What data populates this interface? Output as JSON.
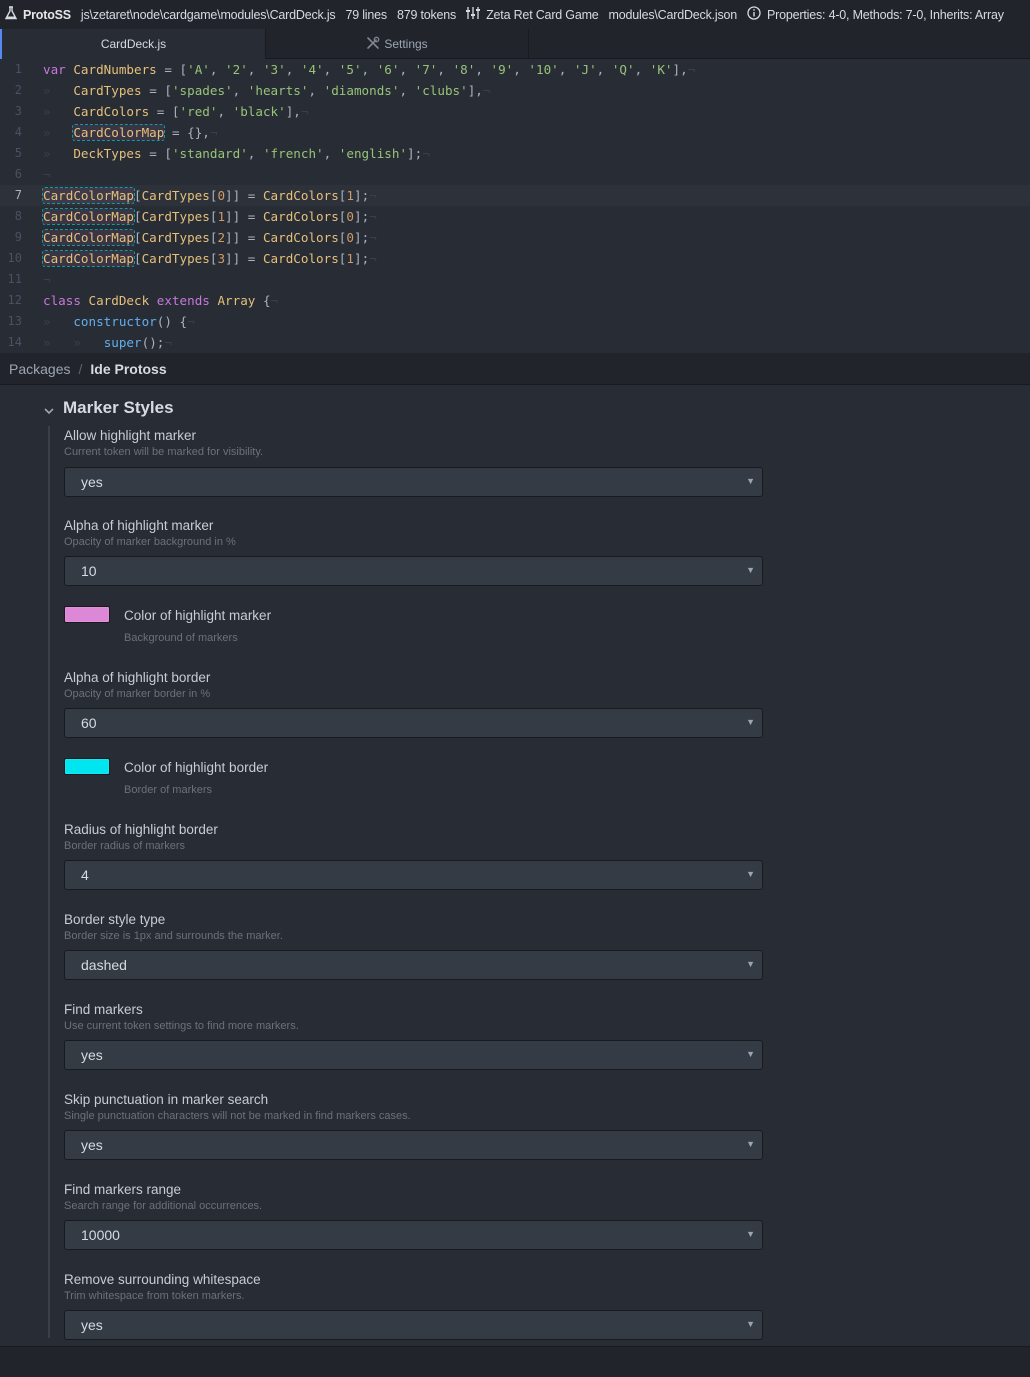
{
  "statusbar": {
    "app_name": "ProtoSS",
    "file_path": "js\\zetaret\\node\\cardgame\\modules\\CardDeck.js",
    "lines": "79 lines",
    "tokens": "879 tokens",
    "project": "Zeta Ret Card Game",
    "json_file": "modules\\CardDeck.json",
    "info": "Properties: 4-0, Methods: 7-0, Inherits: Array"
  },
  "tabs": [
    {
      "label": "CardDeck.js",
      "active": true
    },
    {
      "label": "Settings",
      "active": false,
      "icon": "settings-tools-icon"
    }
  ],
  "editor": {
    "line_numbers": [
      "1",
      "2",
      "3",
      "4",
      "5",
      "6",
      "7",
      "8",
      "9",
      "10",
      "11",
      "12",
      "13",
      "14"
    ],
    "current_line": 7
  },
  "breadcrumb": {
    "root": "Packages",
    "separator": "/",
    "current": "Ide Protoss"
  },
  "settings": {
    "section_title": "Marker Styles",
    "fields": [
      {
        "title": "Allow highlight marker",
        "desc": "Current token will be marked for visibility.",
        "value": "yes"
      },
      {
        "title": "Alpha of highlight marker",
        "desc": "Opacity of marker background in %",
        "value": "10"
      },
      {
        "title": "Alpha of highlight border",
        "desc": "Opacity of marker border in %",
        "value": "60"
      },
      {
        "title": "Radius of highlight border",
        "desc": "Border radius of markers",
        "value": "4"
      },
      {
        "title": "Border style type",
        "desc": "Border size is 1px and surrounds the marker.",
        "value": "dashed"
      },
      {
        "title": "Find markers",
        "desc": "Use current token settings to find more markers.",
        "value": "yes"
      },
      {
        "title": "Skip punctuation in marker search",
        "desc": "Single punctuation characters will not be marked in find markers cases.",
        "value": "yes"
      },
      {
        "title": "Find markers range",
        "desc": "Search range for additional occurrences.",
        "value": "10000"
      },
      {
        "title": "Remove surrounding whitespace",
        "desc": "Trim whitespace from token markers.",
        "value": "yes"
      }
    ],
    "colors": [
      {
        "title": "Color of highlight marker",
        "desc": "Background of markers",
        "color": "#dd88d6"
      },
      {
        "title": "Color of highlight border",
        "desc": "Border of markers",
        "color": "#00e6f0"
      }
    ]
  },
  "theme": {
    "accent": "#568af2",
    "background": "#282c34",
    "panel": "#21252b"
  }
}
